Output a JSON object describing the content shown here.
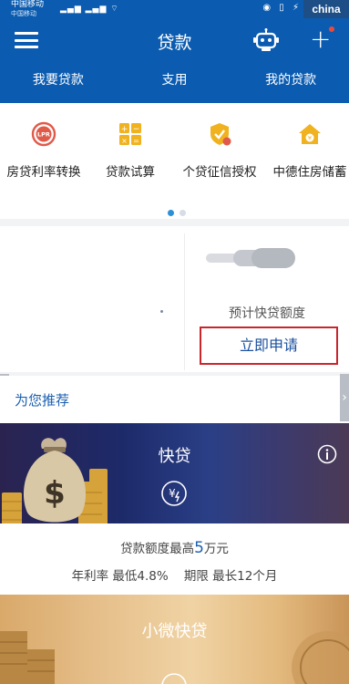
{
  "statusbar": {
    "carrier_line1": "中国移动",
    "carrier_line2": "中国移动",
    "watermark": "china"
  },
  "header": {
    "title": "贷款",
    "menu_icon": "hamburger-menu-icon",
    "robot_icon": "robot-assistant-icon",
    "plus_icon": "plus-icon"
  },
  "tabs": [
    {
      "label": "我要贷款"
    },
    {
      "label": "支用"
    },
    {
      "label": "我的贷款"
    }
  ],
  "services": [
    {
      "label": "房贷利率转换",
      "icon": "lpr-icon",
      "icon_text": "LPR",
      "color": "#e05a4a"
    },
    {
      "label": "贷款试算",
      "icon": "calculator-icon",
      "color": "#f0b21f"
    },
    {
      "label": "个贷征信授权",
      "icon": "shield-badge-icon",
      "color": "#f0b21f"
    },
    {
      "label": "中德住房储蓄",
      "icon": "house-icon",
      "color": "#f0b21f"
    }
  ],
  "pager": {
    "active": 0,
    "count": 2,
    "active_color": "#2d8fd6",
    "inactive_color": "#d6dde6"
  },
  "quota": {
    "estimate_label": "预计快贷额度",
    "apply_button": "立即申请"
  },
  "recommend": {
    "label": "为您推荐"
  },
  "kuaidai": {
    "title": "快贷",
    "amount_prefix": "贷款额度最高",
    "amount_value": "5",
    "amount_unit": "万元",
    "rate_line": "年利率 最低4.8%    期限 最长12个月"
  },
  "xiaowei": {
    "title": "小微快贷"
  },
  "colors": {
    "brand": "#0b5cb1",
    "highlight_border": "#c9262c",
    "link": "#1a5fb0"
  }
}
